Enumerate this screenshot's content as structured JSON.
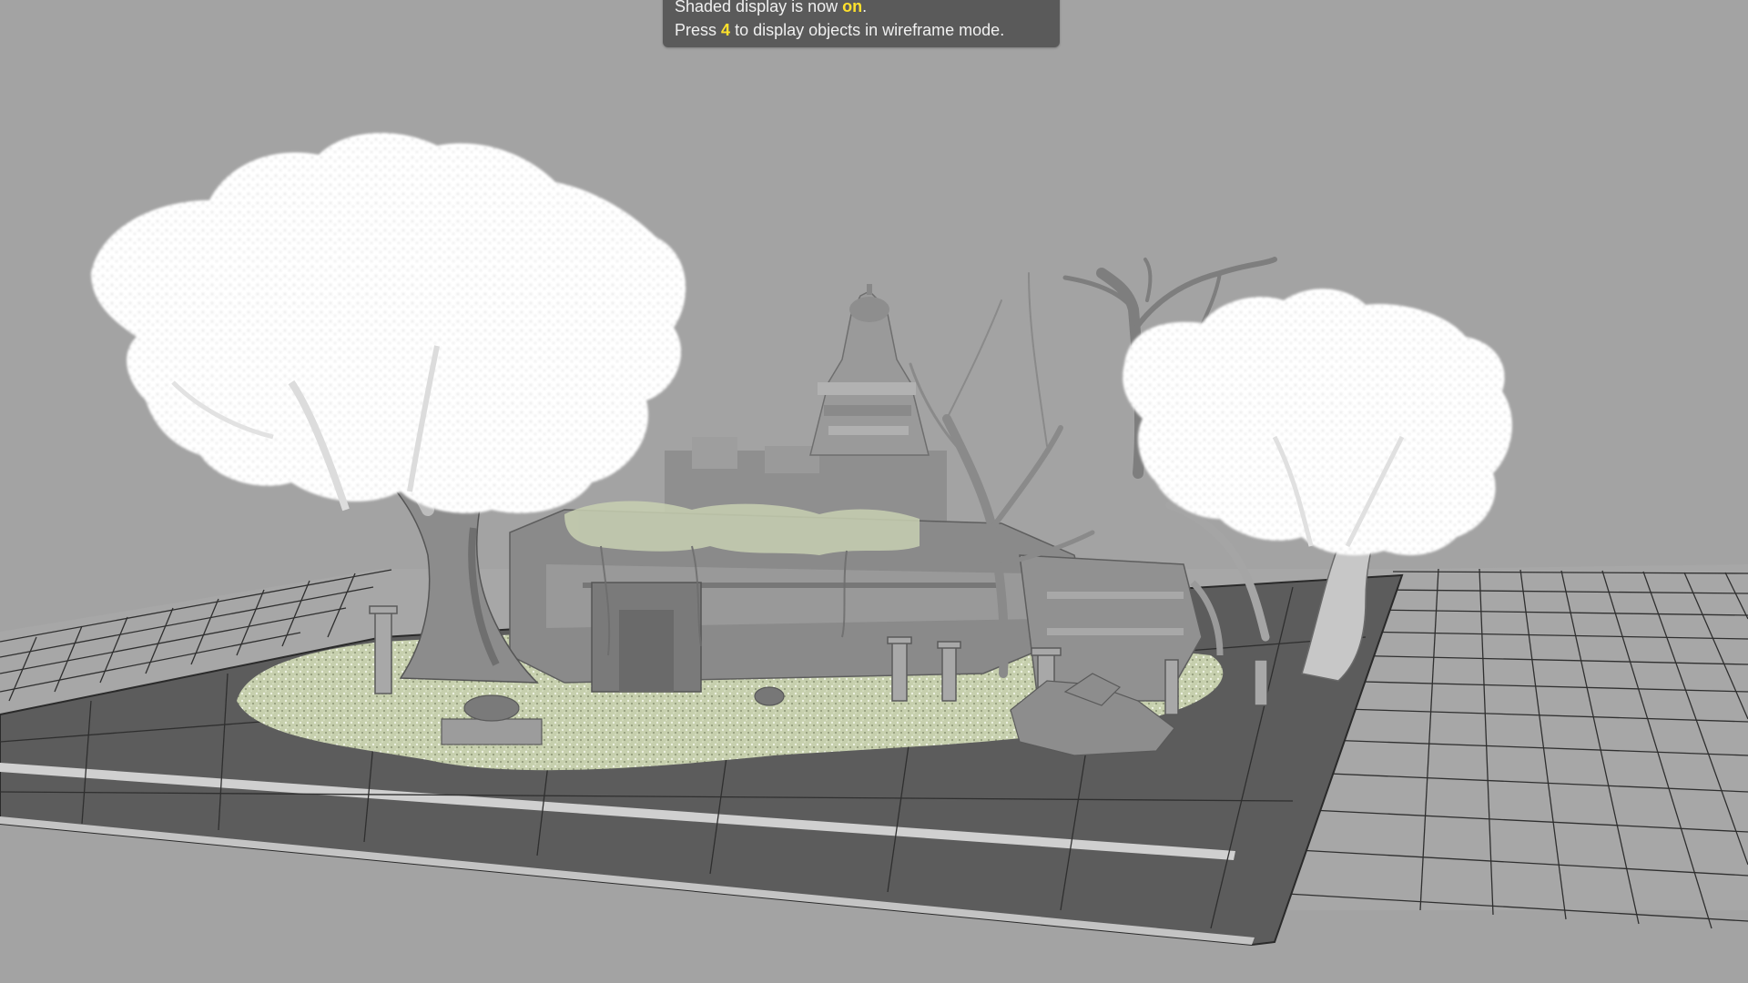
{
  "hud": {
    "line1_prefix": "Shaded display is now",
    "line1_value": "on",
    "line1_suffix": ".",
    "line2_prefix": "Press",
    "line2_key": "4",
    "line2_suffix": "to display objects in wireframe mode."
  },
  "colors": {
    "viewport_background": "#a3a3a3",
    "grid_line": "#2a2a2a",
    "ground_plane": "#5c5c5c",
    "hud_background": "#5a5a5a",
    "hud_highlight": "#ffe12c",
    "foliage": "#ffffff",
    "grass": "#b9c49f"
  }
}
